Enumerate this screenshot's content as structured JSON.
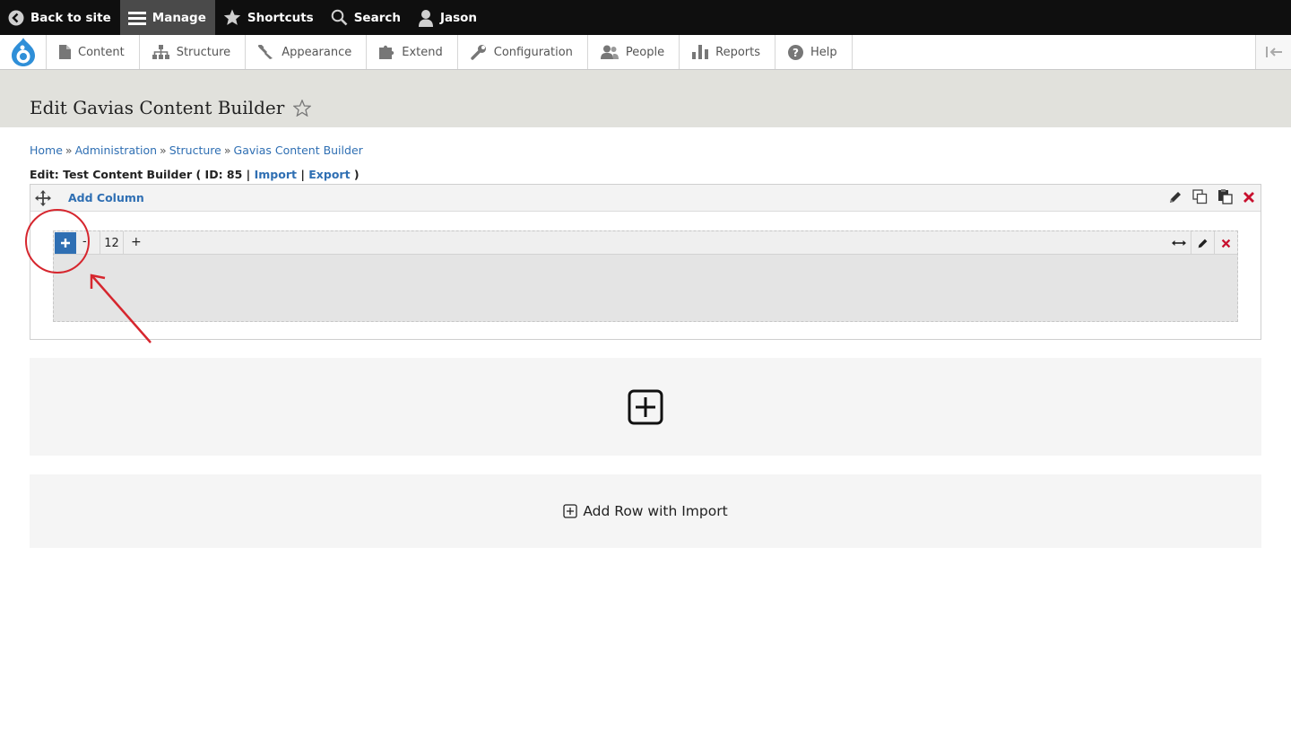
{
  "toolbar": {
    "back_label": "Back to site",
    "manage_label": "Manage",
    "shortcuts_label": "Shortcuts",
    "search_label": "Search",
    "user_label": "Jason"
  },
  "tray": {
    "items": [
      {
        "label": "Content",
        "icon": "file-icon"
      },
      {
        "label": "Structure",
        "icon": "sitemap-icon"
      },
      {
        "label": "Appearance",
        "icon": "paintbrush-icon"
      },
      {
        "label": "Extend",
        "icon": "puzzle-icon"
      },
      {
        "label": "Configuration",
        "icon": "wrench-icon"
      },
      {
        "label": "People",
        "icon": "people-icon"
      },
      {
        "label": "Reports",
        "icon": "bar-chart-icon"
      },
      {
        "label": "Help",
        "icon": "help-icon"
      }
    ]
  },
  "page": {
    "title": "Edit Gavias Content Builder"
  },
  "breadcrumb": {
    "items": [
      "Home",
      "Administration",
      "Structure",
      "Gavias Content Builder"
    ],
    "separator": "»"
  },
  "edit_line": {
    "prefix": "Edit: Test Content Builder ( ID: 85 |",
    "import_label": "Import",
    "divider": "|",
    "export_label": "Export",
    "suffix": ")"
  },
  "builder": {
    "add_column_label": "Add Column",
    "column": {
      "minus_label": "-",
      "size": "12",
      "plus_label": "+"
    },
    "import_row_label": "Add Row with Import"
  },
  "colors": {
    "link": "#2f6fb3",
    "toolbar_bg": "#0f0f0f",
    "header_bg": "#e1e1dc",
    "delete_red": "#c8102e",
    "annotation_red": "#d6262e"
  }
}
